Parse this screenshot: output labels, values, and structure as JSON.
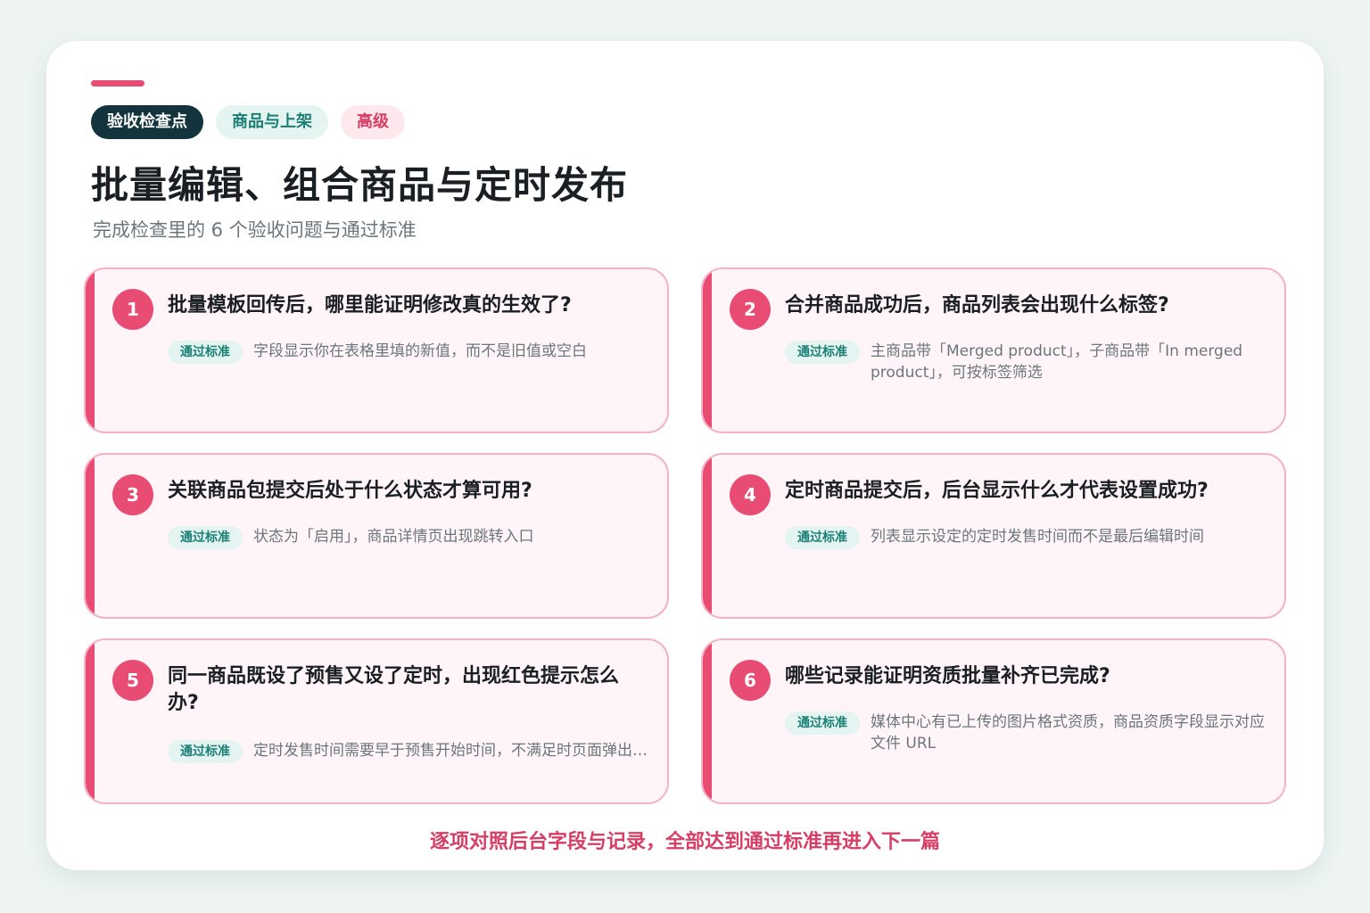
{
  "header": {
    "tags": [
      "验收检查点",
      "商品与上架",
      "高级"
    ],
    "title": "批量编辑、组合商品与定时发布",
    "subtitle": "完成检查里的 6 个验收问题与通过标准"
  },
  "criteria_label": "通过标准",
  "questions": [
    {
      "number": "1",
      "question": "批量模板回传后，哪里能证明修改真的生效了?",
      "criteria": "字段显示你在表格里填的新值，而不是旧值或空白"
    },
    {
      "number": "2",
      "question": "合并商品成功后，商品列表会出现什么标签?",
      "criteria": "主商品带「Merged product」，子商品带「In merged product」，可按标签筛选"
    },
    {
      "number": "3",
      "question": "关联商品包提交后处于什么状态才算可用?",
      "criteria": "状态为「启用」，商品详情页出现跳转入口"
    },
    {
      "number": "4",
      "question": "定时商品提交后，后台显示什么才代表设置成功?",
      "criteria": "列表显示设定的定时发售时间而不是最后编辑时间"
    },
    {
      "number": "5",
      "question": "同一商品既设了预售又设了定时，出现红色提示怎么办?",
      "criteria": "定时发售时间需要早于预售开始时间，不满足时页面弹出红色提示"
    },
    {
      "number": "6",
      "question": "哪些记录能证明资质批量补齐已完成?",
      "criteria": "媒体中心有已上传的图片格式资质，商品资质字段显示对应文件 URL"
    }
  ],
  "footer": "逐项对照后台字段与记录，全部达到通过标准再进入下一篇",
  "colors": {
    "accent": "#e84c73",
    "dark": "#13343c",
    "teal": "#1b7f75",
    "teal_bg": "#e3f4f1",
    "card_bg": "#fff5f8"
  }
}
